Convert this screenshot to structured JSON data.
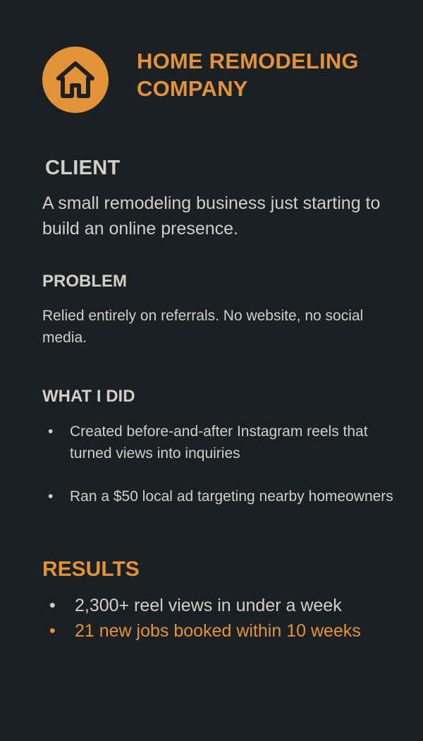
{
  "header": {
    "logo_icon": "house-icon",
    "company_name": "HOME REMODELING COMPANY"
  },
  "client": {
    "heading": "CLIENT",
    "text": "A small remodeling business just starting to build an online presence."
  },
  "problem": {
    "heading": "PROBLEM",
    "text": "Relied entirely on referrals. No website, no social media."
  },
  "what_i_did": {
    "heading": "WHAT I DID",
    "items": [
      "Created before-and-after Instagram reels that turned views into inquiries",
      "Ran a $50 local ad targeting nearby homeowners"
    ]
  },
  "results": {
    "heading": "RESULTS",
    "items": [
      "2,300+ reel views in under a week",
      "21 new jobs booked within 10 weeks"
    ]
  },
  "colors": {
    "background": "#1a2023",
    "accent": "#e49238",
    "text": "#d4cfc6"
  }
}
